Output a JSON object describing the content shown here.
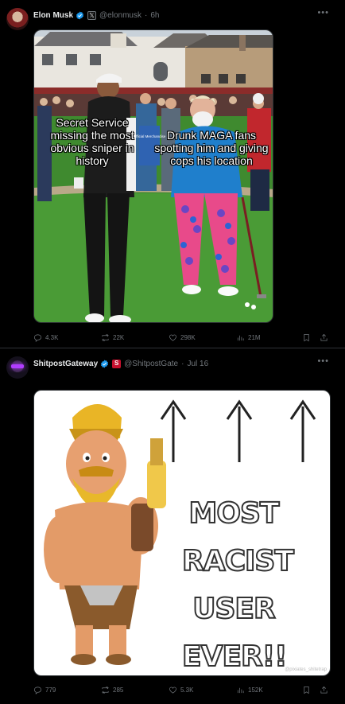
{
  "posts": [
    {
      "author": {
        "name": "Elon Musk",
        "handle": "@elonmusk",
        "time": "6h",
        "affiliation_badge": "𝕏"
      },
      "meme": {
        "caption_left": "Secret Service missing the most obvious sniper in history",
        "caption_right": "Drunk MAGA fans spotting him and giving cops his location",
        "sign_text": "Official Merchandise"
      },
      "stats": {
        "replies": "4.3K",
        "reposts": "22K",
        "likes": "298K",
        "views": "21M"
      }
    },
    {
      "author": {
        "name": "ShitpostGateway",
        "handle": "@ShitpostGate",
        "time": "Jul 16",
        "affiliation_badge": "S"
      },
      "meme": {
        "lines": [
          "MOST",
          "RACIST",
          "USER",
          "EVER!!"
        ],
        "watermark": "@pixiates_shitetrap"
      },
      "stats": {
        "replies": "779",
        "reposts": "285",
        "likes": "5.3K",
        "views": "152K"
      }
    }
  ],
  "colors": {
    "background": "#000000",
    "text": "#e7e9ea",
    "muted": "#71767b",
    "verified": "#1d9bf0",
    "divider": "#2f3336"
  },
  "dot_separator": "·",
  "icons": [
    "reply-icon",
    "repost-icon",
    "like-icon",
    "views-icon",
    "bookmark-icon",
    "share-icon",
    "more-icon",
    "verified-badge-icon"
  ]
}
